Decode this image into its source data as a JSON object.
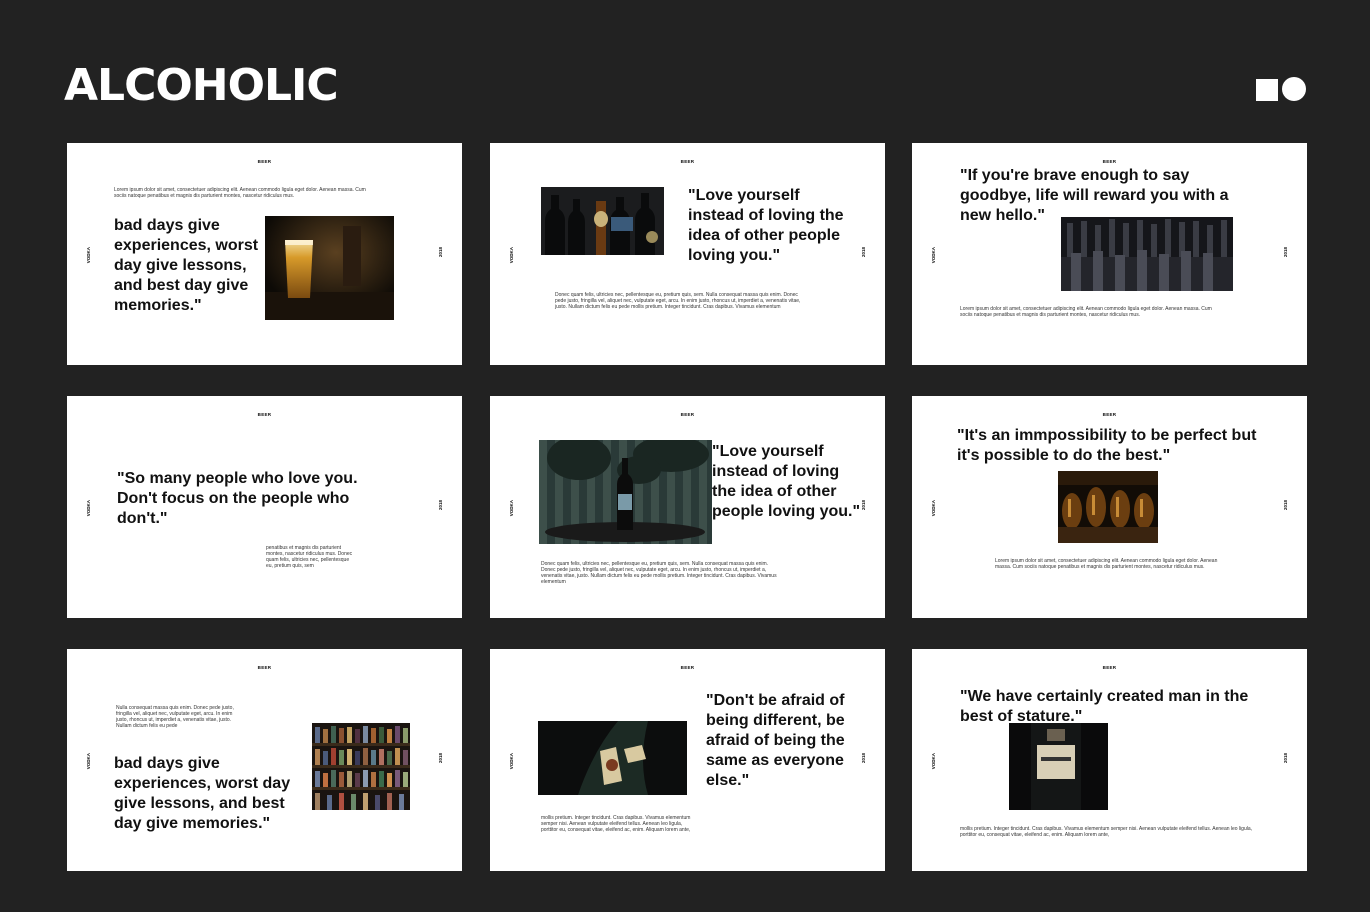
{
  "page": {
    "title": "ALCOHOLIC"
  },
  "colors": {
    "background": "#222222",
    "slide": "#ffffff",
    "text": "#111111"
  },
  "slide_common": {
    "header": "BEER",
    "left_label": "VODKA",
    "right_label": "2018"
  },
  "slides": [
    {
      "quote": "bad days give experiences, worst day give lessons, and best day give memories.\"",
      "body": "Lorem ipsum dolor sit amet, consectetuer adipiscing elit. Aenean commodo ligula eget dolor. Aenean massa. Cum sociis natoque penatibus et magnis dis parturient montes, nascetur ridiculus mus.",
      "image": "beer-glass-photo"
    },
    {
      "quote": "\"Love yourself instead of loving the idea of other people loving you.\"",
      "body": "Donec quam felis, ultricies nec, pellentesque eu, pretium quis, sem. Nulla consequat massa quis enim. Donec pede justo, fringilla vel, aliquet nec, vulputate eget, arcu. In enim justo, rhoncus ut, imperdiet a, venenatis vitae, justo. Nullam dictum felis eu pede mollis pretium. Integer tincidunt. Cras dapibus. Vivamus elementum",
      "image": "beer-bottles-photo"
    },
    {
      "quote": "\"If you're brave enough to say goodbye, life will reward you with a new hello.\"",
      "body": "Lorem ipsum dolor sit amet, consectetuer adipiscing elit. Aenean commodo ligula eget dolor. Aenean massa. Cum sociis natoque penatibus et magnis dis parturient montes, nascetur ridiculus mus.",
      "image": "bottle-rows-photo"
    },
    {
      "quote": "\"So many people who love you. Don't focus on the people who don't.\"",
      "body": "penatibus et magnis dis parturient montes, nascetur ridiculus mus. Donec quam felis, ultricies nec, pellentesque eu, pretium quis, sem",
      "image": ""
    },
    {
      "quote": "\"Love yourself instead of loving the idea of other people loving you.\"",
      "body": "Donec quam felis, ultricies nec, pellentesque eu, pretium quis, sem. Nulla consequat massa quis enim. Donec pede justo, fringilla vel, aliquet nec, vulputate eget, arcu. In enim justo, rhoncus ut, imperdiet a, venenatis vitae, justo. Nullam dictum felis eu pede mollis pretium. Integer tincidunt. Cras dapibus. Vivamus elementum",
      "image": "bottle-plant-photo"
    },
    {
      "quote": "\"It's an immpossibility to be perfect but it's possible to do the best.\"",
      "body": "Lorem ipsum dolor sit amet, consectetuer adipiscing elit. Aenean commodo ligula eget dolor. Aenean massa. Cum sociis natoque penatibus et magnis dis parturient montes, nascetur ridiculus mus.",
      "image": "crate-bottles-photo"
    },
    {
      "quote": "bad days give experiences, worst day give lessons, and best day give memories.\"",
      "body": "Nulla consequat massa quis enim. Donec pede justo, fringilla vel, aliquet nec, vulputate eget, arcu. In enim justo, rhoncus ut, imperdiet a, venenatis vitae, justo. Nullam dictum felis eu pede",
      "image": "bar-shelf-photo"
    },
    {
      "quote": "\"Don't be afraid of being different, be afraid of being the same as everyone else.\"",
      "body": "mollis pretium. Integer tincidunt. Cras dapibus. Vivamus elementum semper nisi. Aenean vulputate eleifend tellus. Aenean leo ligula, porttitor eu, consequat vitae, eleifend ac, enim. Aliquam lorem ante,",
      "image": "champagne-label-photo"
    },
    {
      "quote": "\"We have certainly created man in the best of stature.\"",
      "body": "mollis pretium. Integer tincidunt. Cras dapibus. Vivamus elementum semper nisi. Aenean vulputate eleifend tellus. Aenean leo ligula, porttitor eu, consequat vitae, eleifend ac, enim. Aliquam lorem ante,",
      "image": "bollinger-bottle-photo"
    }
  ]
}
